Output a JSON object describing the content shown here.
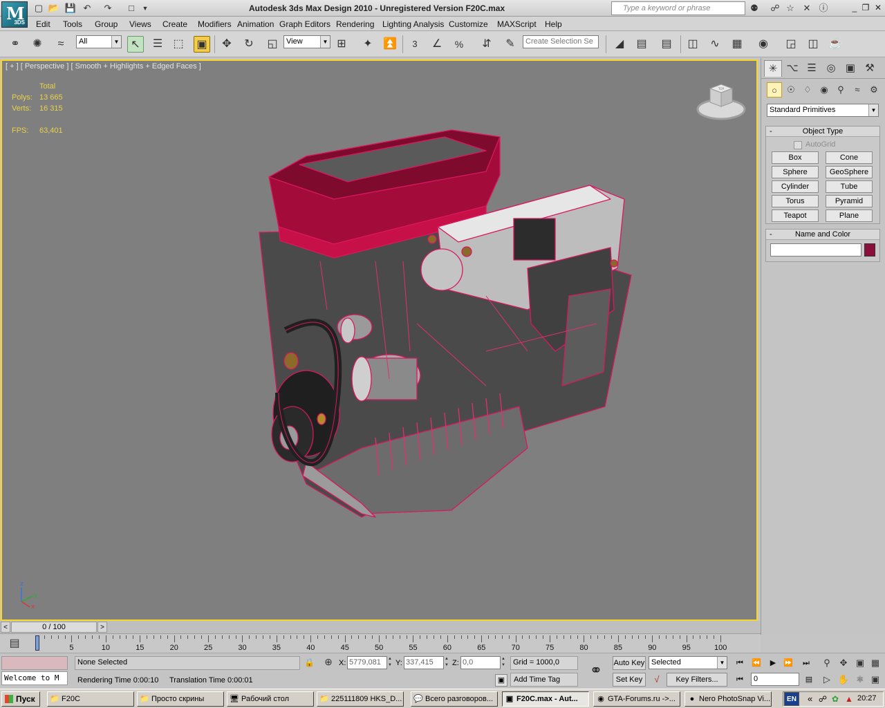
{
  "titlebar": {
    "app_title": "Autodesk 3ds Max Design 2010  - Unregistered Version     F20C.max",
    "logo_letter": "M",
    "logo_sub": "3DS",
    "search_placeholder": "Type a keyword or phrase",
    "quick_access": [
      "new-icon",
      "open-icon",
      "save-icon",
      "undo-icon",
      "redo-icon",
      "project-icon"
    ]
  },
  "menu": [
    "Edit",
    "Tools",
    "Group",
    "Views",
    "Create",
    "Modifiers",
    "Animation",
    "Graph Editors",
    "Rendering",
    "Lighting Analysis",
    "Customize",
    "MAXScript",
    "Help"
  ],
  "toolbar": {
    "selection_filter": "All",
    "ref_coord": "View",
    "named_selection_placeholder": "Create Selection Se",
    "snap_3": "3",
    "snap_percent": "%"
  },
  "viewport": {
    "label": "[ + ] [ Perspective ] [ Smooth + Highlights + Edged Faces ]",
    "stats": {
      "header": "Total",
      "polys_label": "Polys:",
      "polys_value": "13 665",
      "verts_label": "Verts:",
      "verts_value": "16 315",
      "fps_label": "FPS:",
      "fps_value": "63,401"
    },
    "background": "#7f7f7f",
    "border_color": "#f6d72a",
    "wire_color": "#d8185f",
    "axis_labels": {
      "z": "z",
      "y": "y",
      "x": "x"
    },
    "cube_labels": {
      "top": "TOP",
      "front": "FRONT",
      "left": "LEFT"
    }
  },
  "command_panel": {
    "category": "Standard Primitives",
    "object_type_title": "Object Type",
    "autogrid": "AutoGrid",
    "primitives": [
      "Box",
      "Cone",
      "Sphere",
      "GeoSphere",
      "Cylinder",
      "Tube",
      "Torus",
      "Pyramid",
      "Teapot",
      "Plane"
    ],
    "name_color_title": "Name and Color",
    "object_name": "",
    "object_color": "#8a0f3a",
    "collapse_symbol": "-"
  },
  "time_slider": {
    "position_text": "0 / 100",
    "prev": "<",
    "next": ">"
  },
  "trackbar": {
    "ticks": [
      "0",
      "5",
      "10",
      "15",
      "20",
      "25",
      "30",
      "35",
      "40",
      "45",
      "50",
      "55",
      "60",
      "65",
      "70",
      "75",
      "80",
      "85",
      "90",
      "95",
      "100"
    ],
    "current_frame": 0
  },
  "status": {
    "maxscript_listener": "Welcome to M",
    "selection": "None Selected",
    "rendering_time": "Rendering Time  0:00:10",
    "translation_time": "Translation Time  0:00:01",
    "x_label": "X:",
    "x_value": "5779,081",
    "y_label": "Y:",
    "y_value": "337,415",
    "z_label": "Z:",
    "z_value": "0,0",
    "grid": "Grid = 1000,0",
    "add_time_tag": "Add Time Tag",
    "auto_key": "Auto Key",
    "set_key": "Set Key",
    "key_mode": "Selected",
    "key_filters": "Key Filters...",
    "current_frame": "0"
  },
  "taskbar": {
    "start": "Пуск",
    "tasks": [
      {
        "label": "F20C",
        "icon": "folder-icon",
        "active": false
      },
      {
        "label": "Просто скрины",
        "icon": "folder-icon",
        "active": false
      },
      {
        "label": "Рабочий стол",
        "icon": "desktop-icon",
        "active": false
      },
      {
        "label": "225111809 HKS_D...",
        "icon": "folder-icon",
        "active": false
      },
      {
        "label": "Всего разговоров...",
        "icon": "chat-icon",
        "active": false
      },
      {
        "label": "F20C.max - Aut...",
        "icon": "max-icon",
        "active": true
      },
      {
        "label": "GTA-Forums.ru ->...",
        "icon": "firefox-icon",
        "active": false
      },
      {
        "label": "Nero PhotoSnap Vi...",
        "icon": "nero-icon",
        "active": false
      }
    ],
    "language": "EN",
    "tray_chevron": "«",
    "clock": "20:27"
  }
}
